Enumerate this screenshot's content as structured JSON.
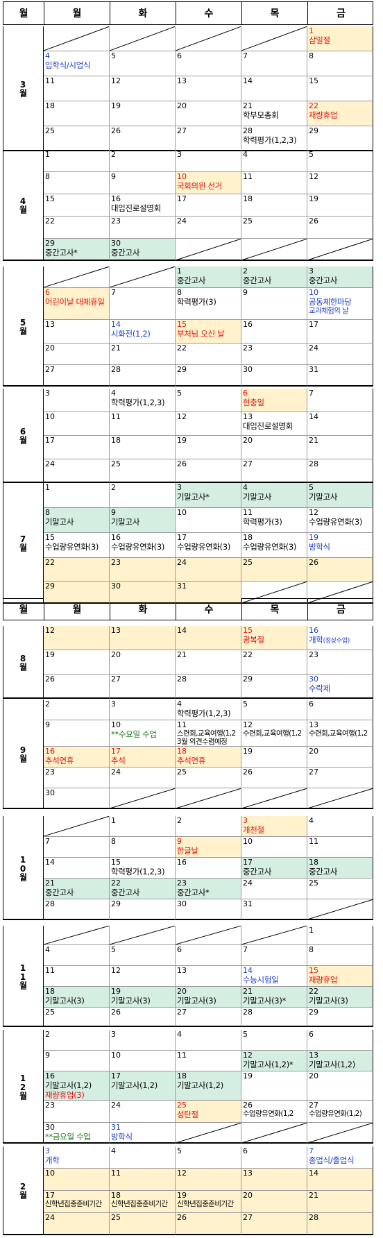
{
  "header": {
    "month": "월",
    "days": [
      "월",
      "화",
      "수",
      "목",
      "금"
    ]
  },
  "months": [
    {
      "label": "3월",
      "rows": [
        [
          {
            "blank": true
          },
          {
            "blank": true
          },
          {
            "blank": true
          },
          {
            "blank": true
          },
          {
            "d": "1",
            "t": "삼일절",
            "bg": "y",
            "c": "red"
          }
        ],
        [
          {
            "d": "4",
            "t": "입학식/시업식",
            "c": "blue"
          },
          {
            "d": "5"
          },
          {
            "d": "6"
          },
          {
            "d": "7"
          },
          {
            "d": "8"
          }
        ],
        [
          {
            "d": "11"
          },
          {
            "d": "12"
          },
          {
            "d": "13"
          },
          {
            "d": "14"
          },
          {
            "d": "15"
          }
        ],
        [
          {
            "d": "18"
          },
          {
            "d": "19"
          },
          {
            "d": "20"
          },
          {
            "d": "21",
            "t": "학부모총회"
          },
          {
            "d": "22",
            "t": "재량휴업",
            "bg": "y",
            "c": "red"
          }
        ],
        [
          {
            "d": "25"
          },
          {
            "d": "26"
          },
          {
            "d": "27"
          },
          {
            "d": "28",
            "t": "학력평가(1,2,3)"
          },
          {
            "d": "29"
          }
        ]
      ]
    },
    {
      "label": "4월",
      "rows": [
        [
          {
            "d": "1"
          },
          {
            "d": "2"
          },
          {
            "d": "3"
          },
          {
            "d": "4"
          },
          {
            "d": "5"
          }
        ],
        [
          {
            "d": "8"
          },
          {
            "d": "9"
          },
          {
            "d": "10",
            "t": "국회의원 선거",
            "bg": "y",
            "c": "red"
          },
          {
            "d": "11"
          },
          {
            "d": "12"
          }
        ],
        [
          {
            "d": "15"
          },
          {
            "d": "16",
            "t": "대입진로설명회"
          },
          {
            "d": "17"
          },
          {
            "d": "18"
          },
          {
            "d": "19"
          }
        ],
        [
          {
            "d": "22"
          },
          {
            "d": "23"
          },
          {
            "d": "24"
          },
          {
            "d": "25"
          },
          {
            "d": "26"
          }
        ],
        [
          {
            "d": "29",
            "t": "중간고사*",
            "bg": "g"
          },
          {
            "d": "30",
            "t": "중간고사",
            "bg": "g"
          },
          {
            "blank": true
          },
          {
            "blank": true
          },
          {
            "blank": true
          }
        ]
      ]
    },
    {
      "label": "5월",
      "rows": [
        [
          {
            "blank": true
          },
          {
            "blank": true
          },
          {
            "d": "1",
            "t": "중간고사",
            "bg": "g"
          },
          {
            "d": "2",
            "t": "중간고사",
            "bg": "g"
          },
          {
            "d": "3",
            "t": "중간고사",
            "bg": "g"
          }
        ],
        [
          {
            "d": "6",
            "t": "어린이날 대체휴일",
            "bg": "y",
            "c": "red"
          },
          {
            "d": "7"
          },
          {
            "d": "8",
            "t": "학력평가(3)"
          },
          {
            "d": "9"
          },
          {
            "d": "10",
            "t": "공동체한마당",
            "t2": "교과체험의 날",
            "c": "blue"
          }
        ],
        [
          {
            "d": "13"
          },
          {
            "d": "14",
            "t": "시화전(1,2)",
            "c": "blue"
          },
          {
            "d": "15",
            "t": "부처님 오신 날",
            "bg": "y",
            "c": "red"
          },
          {
            "d": "16"
          },
          {
            "d": "17"
          }
        ],
        [
          {
            "d": "20"
          },
          {
            "d": "21"
          },
          {
            "d": "22"
          },
          {
            "d": "23"
          },
          {
            "d": "24"
          }
        ],
        [
          {
            "d": "27"
          },
          {
            "d": "28"
          },
          {
            "d": "29"
          },
          {
            "d": "30"
          },
          {
            "d": "31"
          }
        ]
      ]
    },
    {
      "label": "6월",
      "rows": [
        [
          {
            "d": "3"
          },
          {
            "d": "4",
            "t": "학력평가(1,2,3)"
          },
          {
            "d": "5"
          },
          {
            "d": "6",
            "t": "현충일",
            "bg": "y",
            "c": "red"
          },
          {
            "d": "7"
          }
        ],
        [
          {
            "d": "10"
          },
          {
            "d": "11"
          },
          {
            "d": "12"
          },
          {
            "d": "13",
            "t": "대입진로설명회"
          },
          {
            "d": "14"
          }
        ],
        [
          {
            "d": "17"
          },
          {
            "d": "18"
          },
          {
            "d": "19"
          },
          {
            "d": "20"
          },
          {
            "d": "21"
          }
        ],
        [
          {
            "d": "24"
          },
          {
            "d": "25"
          },
          {
            "d": "26"
          },
          {
            "d": "27"
          },
          {
            "d": "28"
          }
        ]
      ]
    },
    {
      "label": "7월",
      "rows": [
        [
          {
            "d": "1"
          },
          {
            "d": "2"
          },
          {
            "d": "3",
            "t": "기말고사*",
            "bg": "g"
          },
          {
            "d": "4",
            "t": "기말고사",
            "bg": "g"
          },
          {
            "d": "5",
            "t": "기말고사",
            "bg": "g"
          }
        ],
        [
          {
            "d": "8",
            "t": "기말고사",
            "bg": "g"
          },
          {
            "d": "9",
            "t": "기말고사",
            "bg": "g"
          },
          {
            "d": "10"
          },
          {
            "d": "11",
            "t": "학력평가(3)"
          },
          {
            "d": "12",
            "t": "수업량유연화(3)"
          }
        ],
        [
          {
            "d": "15",
            "t": "수업량유연화(3)"
          },
          {
            "d": "16",
            "t": "수업량유연화(3)"
          },
          {
            "d": "17",
            "t": "수업량유연화(3)"
          },
          {
            "d": "18",
            "t": "수업량유연화(3)"
          },
          {
            "d": "19",
            "t": "방학식",
            "c": "blue"
          }
        ],
        [
          {
            "d": "22",
            "bg": "y"
          },
          {
            "d": "23",
            "bg": "y"
          },
          {
            "d": "24",
            "bg": "y"
          },
          {
            "d": "25",
            "bg": "y"
          },
          {
            "d": "26",
            "bg": "y"
          }
        ],
        [
          {
            "d": "29",
            "bg": "y"
          },
          {
            "d": "30",
            "bg": "y"
          },
          {
            "d": "31",
            "bg": "y"
          },
          {
            "blank": true
          },
          {
            "blank": true
          }
        ]
      ]
    },
    {
      "label": "8월",
      "rows": [
        [
          {
            "d": "12",
            "bg": "y"
          },
          {
            "d": "13",
            "bg": "y"
          },
          {
            "d": "14",
            "bg": "y"
          },
          {
            "d": "15",
            "t": "광복절",
            "bg": "y",
            "c": "red"
          },
          {
            "d": "16",
            "t": "개학",
            "sm": "(정상수업)",
            "c": "blue"
          }
        ],
        [
          {
            "d": "19"
          },
          {
            "d": "20"
          },
          {
            "d": "21"
          },
          {
            "d": "22"
          },
          {
            "d": "23"
          }
        ],
        [
          {
            "d": "26"
          },
          {
            "d": "27"
          },
          {
            "d": "28"
          },
          {
            "d": "29"
          },
          {
            "d": "30",
            "t": "수락제",
            "c": "blue"
          }
        ]
      ]
    },
    {
      "label": "9월",
      "rows": [
        [
          {
            "d": "2"
          },
          {
            "d": "3"
          },
          {
            "d": "4",
            "t": "학력평가(1,2,3)"
          },
          {
            "d": "5"
          },
          {
            "d": "6"
          }
        ],
        [
          {
            "d": "9"
          },
          {
            "d": "10",
            "t": "**수요일 수업",
            "c": "grn"
          },
          {
            "d": "11",
            "t2": "스련회,교육여행(1,2",
            "t3": "3월 의견수렴예정"
          },
          {
            "d": "12",
            "t2": "수련회,교육여행(1,2"
          },
          {
            "d": "13",
            "t2": "수련회,교육여행(1,2"
          }
        ],
        [
          {
            "d": "16",
            "t": "추석연휴",
            "bg": "y",
            "c": "red"
          },
          {
            "d": "17",
            "t": "추석",
            "bg": "y",
            "c": "red"
          },
          {
            "d": "18",
            "t": "추석연휴",
            "bg": "y",
            "c": "red"
          },
          {
            "d": "19"
          },
          {
            "d": "20"
          }
        ],
        [
          {
            "d": "23"
          },
          {
            "d": "24"
          },
          {
            "d": "25"
          },
          {
            "d": "26"
          },
          {
            "d": "27"
          }
        ],
        [
          {
            "d": "30"
          },
          {
            "blank": true
          },
          {
            "blank": true
          },
          {
            "blank": true
          },
          {
            "blank": true
          }
        ]
      ]
    },
    {
      "label": "10월",
      "rows": [
        [
          {
            "blank": true
          },
          {
            "d": "1"
          },
          {
            "d": "2"
          },
          {
            "d": "3",
            "t": "개천절",
            "bg": "y",
            "c": "red"
          },
          {
            "d": "4"
          }
        ],
        [
          {
            "d": "7"
          },
          {
            "d": "8"
          },
          {
            "d": "9",
            "t": "한글날",
            "bg": "y",
            "c": "red"
          },
          {
            "d": "10"
          },
          {
            "d": "11"
          }
        ],
        [
          {
            "d": "14"
          },
          {
            "d": "15",
            "t": "학력평가(1,2,3)"
          },
          {
            "d": "16"
          },
          {
            "d": "17",
            "t": "중간고사",
            "bg": "g"
          },
          {
            "d": "18",
            "t": "중간고사",
            "bg": "g"
          }
        ],
        [
          {
            "d": "21",
            "t": "중간고사",
            "bg": "g"
          },
          {
            "d": "22",
            "t": "중간고사",
            "bg": "g"
          },
          {
            "d": "23",
            "t": "중간고사*",
            "bg": "g"
          },
          {
            "d": "24"
          },
          {
            "d": "25"
          }
        ],
        [
          {
            "d": "28"
          },
          {
            "d": "29"
          },
          {
            "d": "30"
          },
          {
            "d": "31"
          },
          {
            "blank": true
          }
        ]
      ]
    },
    {
      "label": "11월",
      "rows": [
        [
          {
            "blank": true
          },
          {
            "blank": true
          },
          {
            "blank": true
          },
          {
            "blank": true
          },
          {
            "d": "1"
          }
        ],
        [
          {
            "d": "4"
          },
          {
            "d": "5"
          },
          {
            "d": "6"
          },
          {
            "d": "7"
          },
          {
            "d": "8"
          }
        ],
        [
          {
            "d": "11"
          },
          {
            "d": "12"
          },
          {
            "d": "13"
          },
          {
            "d": "14",
            "t": "수능시험일",
            "c": "blue"
          },
          {
            "d": "15",
            "t": "재량휴업",
            "bg": "y",
            "c": "red"
          }
        ],
        [
          {
            "d": "18",
            "t": "기말고사(3)",
            "bg": "g"
          },
          {
            "d": "19",
            "t": "기말고사(3)",
            "bg": "g"
          },
          {
            "d": "20",
            "t": "기말고사(3)",
            "bg": "g"
          },
          {
            "d": "21",
            "t": "기말고사(3)*",
            "bg": "g"
          },
          {
            "d": "22",
            "t": "기말고사(3)",
            "bg": "g"
          }
        ],
        [
          {
            "d": "25"
          },
          {
            "d": "26"
          },
          {
            "d": "27"
          },
          {
            "d": "28"
          },
          {
            "d": "29"
          }
        ]
      ]
    },
    {
      "label": "12월",
      "rows": [
        [
          {
            "d": "2"
          },
          {
            "d": "3"
          },
          {
            "d": "4"
          },
          {
            "d": "5"
          },
          {
            "d": "6"
          }
        ],
        [
          {
            "d": "9"
          },
          {
            "d": "10"
          },
          {
            "d": "11"
          },
          {
            "d": "12",
            "t": "기말고사(1,2)*",
            "bg": "g"
          },
          {
            "d": "13",
            "t": "기말고사(1,2)",
            "bg": "g"
          }
        ],
        [
          {
            "d": "16",
            "t": "기말고사(1,2)",
            "t4": "재량휴업(3)",
            "bg": "g"
          },
          {
            "d": "17",
            "t": "기말고사(1,2)",
            "bg": "g"
          },
          {
            "d": "18",
            "t": "기말고사(1,2)",
            "bg": "g"
          },
          {
            "d": "19"
          },
          {
            "d": "20"
          }
        ],
        [
          {
            "d": "23"
          },
          {
            "d": "24"
          },
          {
            "d": "25",
            "t": "성탄절",
            "bg": "y",
            "c": "red"
          },
          {
            "d": "26",
            "t2": "수업량유연화(1,2"
          },
          {
            "d": "27",
            "t2": "수업량유연화(1,2)"
          }
        ],
        [
          {
            "d": "30",
            "t": "**금요일 수업",
            "c": "grn"
          },
          {
            "d": "31",
            "t": "방학식",
            "c": "blue"
          },
          {
            "blank": true
          },
          {
            "blank": true
          },
          {
            "blank": true
          }
        ]
      ]
    },
    {
      "label": "2월",
      "rows": [
        [
          {
            "d": "3",
            "t": "개학",
            "c": "blue"
          },
          {
            "d": "4"
          },
          {
            "d": "5"
          },
          {
            "d": "6"
          },
          {
            "d": "7",
            "t": "종업식/졸업식",
            "c": "blue"
          }
        ],
        [
          {
            "d": "10",
            "bg": "y"
          },
          {
            "d": "11",
            "bg": "y"
          },
          {
            "d": "12",
            "bg": "y"
          },
          {
            "d": "13",
            "bg": "y"
          },
          {
            "d": "14",
            "bg": "y"
          }
        ],
        [
          {
            "d": "17",
            "t2": "신학년집중준비기간",
            "bg": "y"
          },
          {
            "d": "18",
            "t2": "신학년집중준비기간",
            "bg": "y"
          },
          {
            "d": "19",
            "t2": "신학년집중준비기간",
            "bg": "y"
          },
          {
            "d": "20",
            "bg": "y"
          },
          {
            "d": "21",
            "bg": "y"
          }
        ],
        [
          {
            "d": "24",
            "bg": "y"
          },
          {
            "d": "25",
            "bg": "y"
          },
          {
            "d": "26",
            "bg": "y"
          },
          {
            "d": "27",
            "bg": "y"
          },
          {
            "d": "28",
            "bg": "y"
          }
        ]
      ]
    }
  ]
}
